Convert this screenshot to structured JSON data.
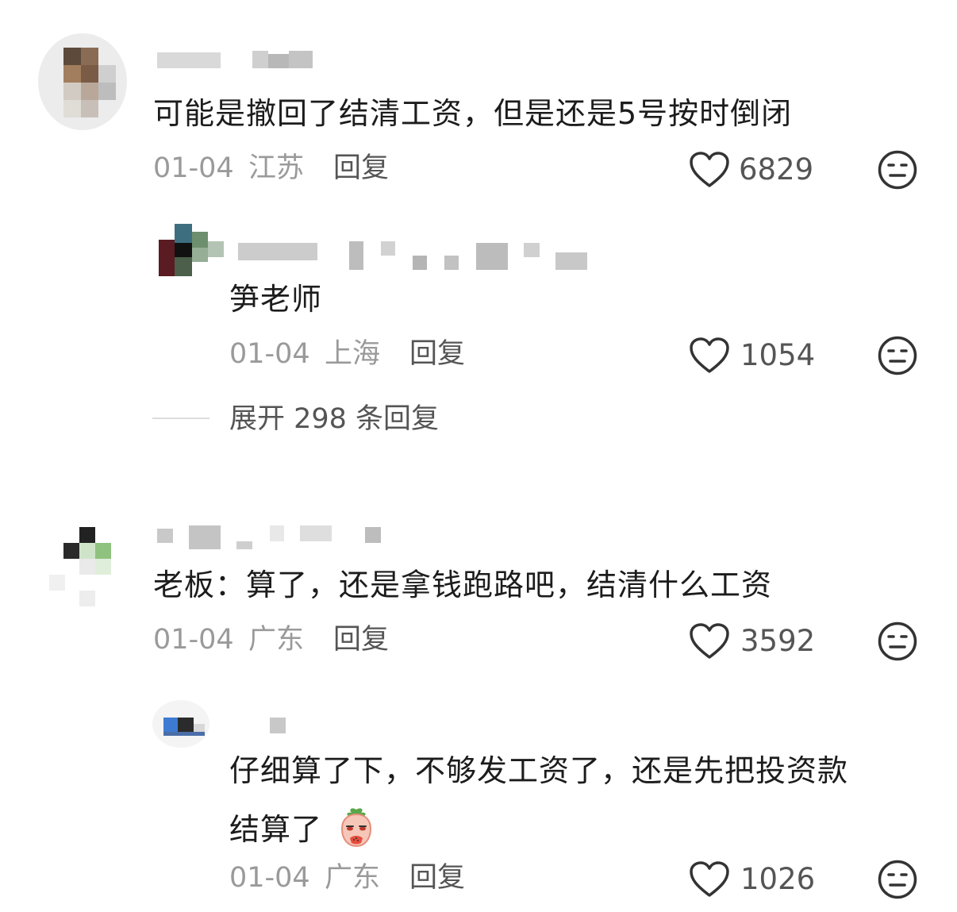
{
  "comments": [
    {
      "text": "可能是撤回了结清工资，但是还是5号按时倒闭",
      "date": "01-04",
      "location": "江苏",
      "reply_label": "回复",
      "likes": "6829",
      "reply": {
        "text": "笋老师",
        "date": "01-04",
        "location": "上海",
        "reply_label": "回复",
        "likes": "1054"
      },
      "expand_label": "展开 298 条回复"
    },
    {
      "text": "老板：算了，还是拿钱跑路吧，结清什么工资",
      "date": "01-04",
      "location": "广东",
      "reply_label": "回复",
      "likes": "3592",
      "reply": {
        "text_line1": "仔细算了下，不够发工资了，还是先把投资款",
        "text_line2": "结算了",
        "date": "01-04",
        "location": "广东",
        "reply_label": "回复",
        "likes": "1026"
      }
    }
  ],
  "icons": {
    "like": "heart-outline-icon",
    "more": "neutral-face-icon",
    "sticker": "strawberry-sticker-icon"
  },
  "colors": {
    "text": "#1c1c1c",
    "meta": "#9a9a9a",
    "action": "#555555"
  }
}
